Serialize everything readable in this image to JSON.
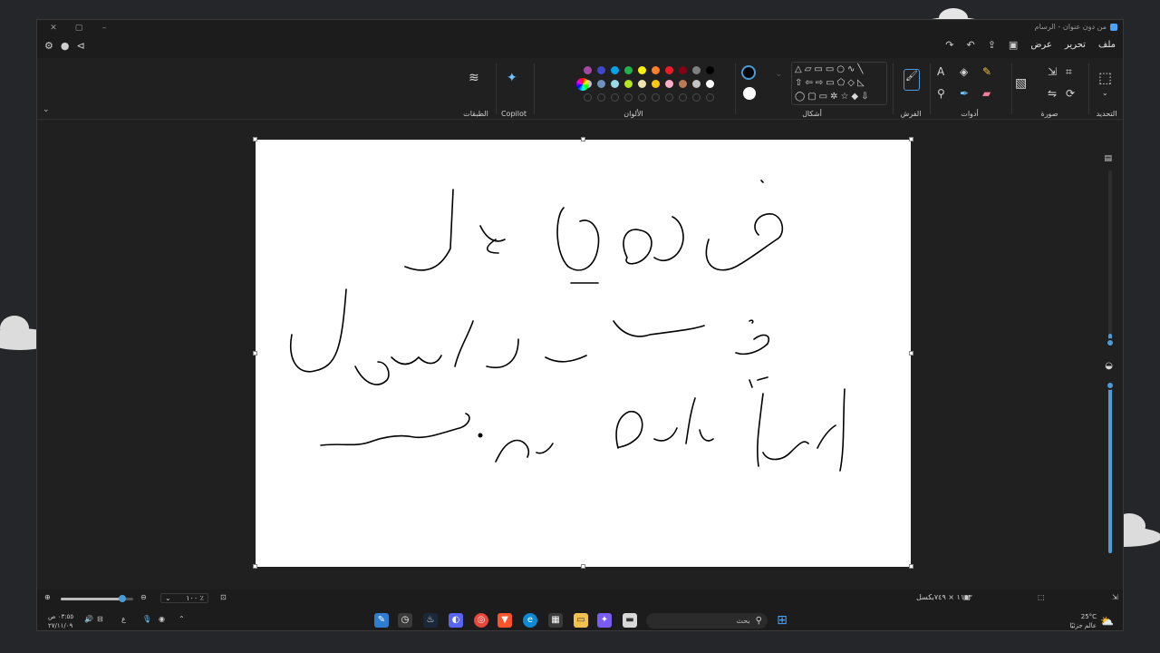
{
  "window": {
    "title": "من دون عنوان - الرسام",
    "min_glyph": "–",
    "max_glyph": "▢",
    "close_glyph": "✕"
  },
  "menu": {
    "items": [
      "ملف",
      "تحرير",
      "عرض"
    ],
    "left_icons": [
      "gear-icon",
      "account-icon",
      "share-feedback-icon"
    ]
  },
  "ribbon": {
    "groups": {
      "selection": "التحديد",
      "image": "صورة",
      "tools": "أدوات",
      "brushes": "الفرش",
      "shapes": "أشكال",
      "colors": "الألوان",
      "copilot": "Copilot",
      "layers": "الطبقات"
    },
    "palette_row1": [
      "#000000",
      "#7f7f7f",
      "#880015",
      "#ed1c24",
      "#ff7f27",
      "#fff200",
      "#22b14c",
      "#00a2e8",
      "#3f48cc",
      "#a349a4"
    ],
    "palette_row2": [
      "#ffffff",
      "#c3c3c3",
      "#b97a57",
      "#ffaec9",
      "#ffc90e",
      "#efe4b0",
      "#b5e61d",
      "#99d9ea",
      "#7092be",
      "#c8bfe7"
    ],
    "primary_color": "#000000",
    "secondary_color": "#ffffff"
  },
  "canvas": {
    "lines": [
      "فوشي تُرا",
      "خُـسا لديقول",
      "أنت مثال غير حميد"
    ]
  },
  "statusbar": {
    "canvas_size": "١١٥٣ × ٧٤٩بكسل",
    "zoom": "١٠٠ ٪",
    "zoom_level": 0.85
  },
  "taskbar": {
    "search_placeholder": "بحث",
    "weather_temp": "25°C",
    "weather_label": "عالم جزئيًا",
    "time": "٠٣:٥٥ ص",
    "date": "٢٧/١١/٠٩",
    "language": "ع"
  }
}
